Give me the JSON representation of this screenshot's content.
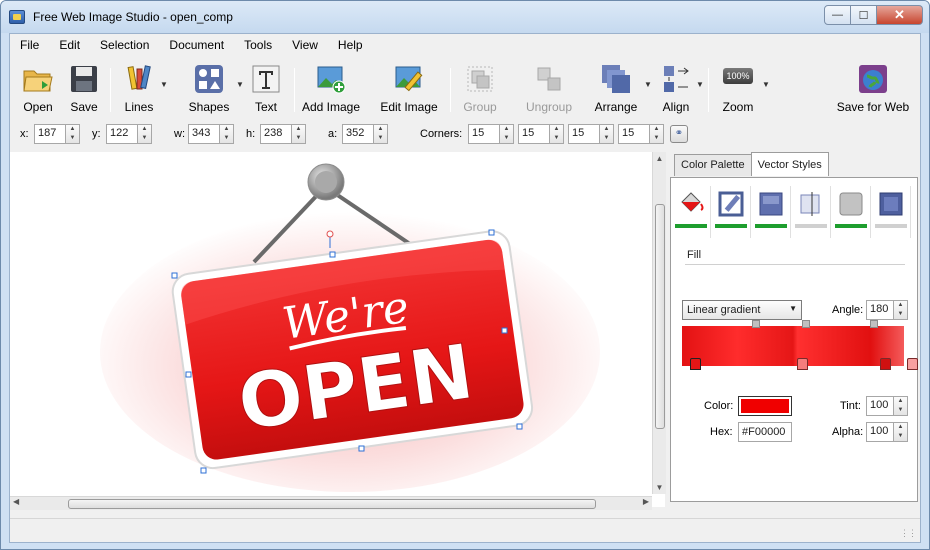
{
  "window": {
    "title": "Free Web Image Studio - open_comp"
  },
  "menu": [
    "File",
    "Edit",
    "Selection",
    "Document",
    "Tools",
    "View",
    "Help"
  ],
  "toolbar": {
    "open": "Open",
    "save": "Save",
    "lines": "Lines",
    "shapes": "Shapes",
    "text": "Text",
    "add_image": "Add Image",
    "edit_image": "Edit Image",
    "group": "Group",
    "ungroup": "Ungroup",
    "arrange": "Arrange",
    "align": "Align",
    "zoom": "Zoom",
    "zoom_badge": "100%",
    "save_for_web": "Save for Web"
  },
  "props": {
    "x_label": "x:",
    "x": "187",
    "y_label": "y:",
    "y": "122",
    "w_label": "w:",
    "w": "343",
    "h_label": "h:",
    "h": "238",
    "a_label": "a:",
    "a": "352",
    "corners_label": "Corners:",
    "corners": [
      "15",
      "15",
      "15",
      "15"
    ]
  },
  "sign": {
    "line1": "We're",
    "line2": "OPEN"
  },
  "panel": {
    "tabs": [
      "Color Palette",
      "Vector Styles"
    ],
    "active_tab": "Vector Styles",
    "section": "Fill",
    "gradient_type": "Linear gradient",
    "angle_label": "Angle:",
    "angle": "180",
    "color_label": "Color:",
    "color": "#F00000",
    "tint_label": "Tint:",
    "tint": "100",
    "hex_label": "Hex:",
    "hex": "#F00000",
    "alpha_label": "Alpha:",
    "alpha": "100"
  },
  "colors": {
    "accent_green": "#1e9e2e",
    "sign_red": "#e51616"
  }
}
